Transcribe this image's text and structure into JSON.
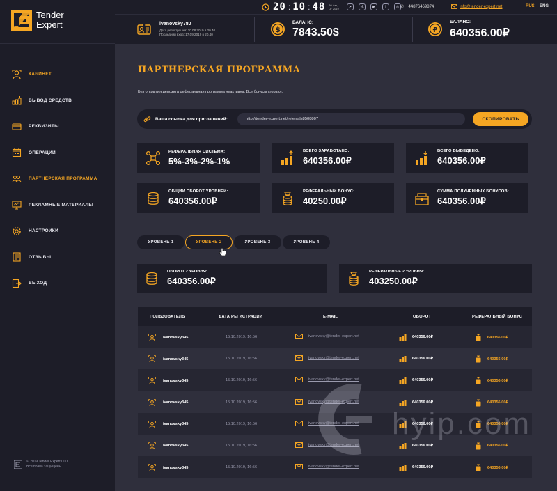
{
  "brand": {
    "name_line1": "Tender",
    "name_line2": "Expert"
  },
  "topbar": {
    "time": {
      "hh": "20",
      "mm": "10",
      "ss": "48"
    },
    "date_small": "30 Авг, Чт 2019",
    "social": [
      "telegram",
      "vk",
      "youtube",
      "facebook",
      "instagram"
    ],
    "phone": "+44876469874",
    "email": "info@tender-expert.net",
    "lang_active": "RUS",
    "lang_other": "ENG"
  },
  "user": {
    "login": "ivanovsky780",
    "registered": "Дата регистрации: 20.08.2019 в 20.40",
    "last_login": "Последний вход: 17.09.2019 в 20.40"
  },
  "balances": [
    {
      "label": "БАЛАНС:",
      "value": "7843.50$",
      "icon": "dollar-coin-icon"
    },
    {
      "label": "БАЛАНС:",
      "value": "640356.00₽",
      "icon": "ruble-coin-icon"
    }
  ],
  "nav": [
    {
      "label": "Кабинет",
      "icon": "user-icon",
      "active": true
    },
    {
      "label": "Вывод средств",
      "icon": "withdraw-icon"
    },
    {
      "label": "Реквизиты",
      "icon": "card-icon"
    },
    {
      "label": "Операции",
      "icon": "calendar-icon"
    },
    {
      "label": "Партнёрская программа",
      "icon": "partners-icon",
      "active_color": true
    },
    {
      "label": "Рекламные материалы",
      "icon": "monitor-icon"
    },
    {
      "label": "Настройки",
      "icon": "gear-icon"
    },
    {
      "label": "Отзывы",
      "icon": "reviews-icon"
    },
    {
      "label": "Выход",
      "icon": "exit-icon"
    }
  ],
  "copyright": {
    "line1": "© 2019 Tender Expert LTD",
    "line2": "Все права защищены"
  },
  "page": {
    "title": "ПАРТНЕРСКАЯ ПРОГРАММА",
    "notice": "Без открытия депозита реферальная программа неактивна. Все бонусы сгорают.",
    "reflink_label": "Ваша ссылка для приглашений:",
    "reflink_value": "http://tender-expert.net/referrals8508807",
    "copy_button": "СКОПИРОВАТЬ"
  },
  "stats": [
    {
      "label": "РЕФЕРАЛЬНАЯ СИСТЕМА:",
      "value": "5%-3%-2%-1%",
      "icon": "network-icon"
    },
    {
      "label": "ВСЕГО ЗАРАБОТАНО:",
      "value": "640356.00₽",
      "icon": "coins-up-icon"
    },
    {
      "label": "ВСЕГО ВЫВЕДЕНО:",
      "value": "640356.00₽",
      "icon": "coins-down-icon"
    },
    {
      "label": "ОБЩИЙ ОБОРОТ УРОВНЕЙ:",
      "value": "640356.00₽",
      "icon": "coin-stack-icon"
    },
    {
      "label": "РЕФЕРАЛЬНЫЙ БОНУС:",
      "value": "40250.00₽",
      "icon": "bonus-stack-icon"
    },
    {
      "label": "СУММА ПОЛУЧЕННЫХ БОНУСОВ:",
      "value": "640356.00₽",
      "icon": "chest-icon"
    }
  ],
  "levels": {
    "tabs": [
      "УРОВЕНЬ 1",
      "УРОВЕНЬ 2",
      "УРОВЕНЬ 3",
      "УРОВЕНЬ 4"
    ],
    "active_index": 1,
    "turnover_label": "ОБОРОТ 2 УРОВНЯ:",
    "turnover_value": "640356.00₽",
    "bonus_label": "РЕФЕРАЛЬНЫЕ 2 УРОВНЯ:",
    "bonus_value": "403250.00₽"
  },
  "table": {
    "columns": [
      "ПОЛЬЗОВАТЕЛЬ",
      "ДАТА РЕГИСТРАЦИИ",
      "E-MAIL",
      "ОБОРОТ",
      "РЕФЕРАЛЬНЫЙ БОНУС"
    ],
    "rows": [
      {
        "user": "ivanovsky345",
        "date": "15.10.2019, 16:56",
        "email": "ivanovsky@tender-expert.net",
        "turnover": "640356.00₽",
        "bonus": "640356.00₽"
      },
      {
        "user": "ivanovsky345",
        "date": "15.10.2019, 16:56",
        "email": "ivanovsky@tender-expert.net",
        "turnover": "640356.00₽",
        "bonus": "640356.00₽"
      },
      {
        "user": "ivanovsky345",
        "date": "15.10.2019, 16:56",
        "email": "ivanovsky@tender-expert.net",
        "turnover": "640356.00₽",
        "bonus": "640356.00₽"
      },
      {
        "user": "ivanovsky345",
        "date": "15.10.2019, 16:56",
        "email": "ivanovsky@tender-expert.net",
        "turnover": "640356.00₽",
        "bonus": "640356.00₽"
      },
      {
        "user": "ivanovsky345",
        "date": "15.10.2019, 16:56",
        "email": "ivanovsky@tender-expert.net",
        "turnover": "640356.00₽",
        "bonus": "640356.00₽"
      },
      {
        "user": "ivanovsky345",
        "date": "15.10.2019, 16:56",
        "email": "ivanovsky@tender-expert.net",
        "turnover": "640356.00₽",
        "bonus": "640356.00₽"
      },
      {
        "user": "ivanovsky345",
        "date": "15.10.2019, 16:56",
        "email": "ivanovsky@tender-expert.net",
        "turnover": "640356.00₽",
        "bonus": "640356.00₽"
      }
    ]
  },
  "watermark": {
    "text": "hyip.com"
  },
  "colors": {
    "accent": "#f5a623",
    "panel": "#1d1d28",
    "background": "#2f2f3c"
  }
}
